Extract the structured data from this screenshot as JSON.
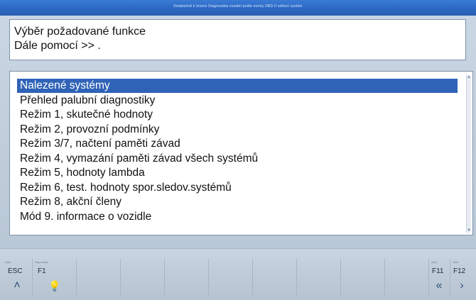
{
  "window": {
    "title": "Dodatečně k licenci Diagnostika vozidel podle normy OBD-II sdílení systém"
  },
  "header": {
    "line1": "Výběr požadované funkce",
    "line2": "Dále pomocí >> ."
  },
  "list": {
    "items": [
      {
        "label": "Nalezené systémy",
        "selected": true
      },
      {
        "label": "Přehled palubní diagnostiky",
        "selected": false
      },
      {
        "label": "Režim 1,  skutečné hodnoty",
        "selected": false
      },
      {
        "label": "Režim 2,  provozní podmínky",
        "selected": false
      },
      {
        "label": "Režim 3/7, načtení paměti závad",
        "selected": false
      },
      {
        "label": "Režim 4,  vymazání paměti závad všech systémů",
        "selected": false
      },
      {
        "label": "Režim 5,  hodnoty lambda",
        "selected": false
      },
      {
        "label": "Režim 6, test. hodnoty spor.sledov.systémů",
        "selected": false
      },
      {
        "label": "Režim 8,  akční členy",
        "selected": false
      },
      {
        "label": "Mód 9. informace o vozidle",
        "selected": false
      }
    ]
  },
  "function_keys": {
    "esc": {
      "label": "ESC",
      "caption": "Zpět",
      "icon": "chevron-up-icon",
      "glyph": "˄"
    },
    "f1": {
      "label": "F1",
      "caption": "Nápověda",
      "icon": "lightbulb-icon",
      "glyph": "💡"
    },
    "f11": {
      "label": "F11",
      "caption": "Zpět",
      "icon": "double-chevron-left-icon",
      "glyph": "«"
    },
    "f12": {
      "label": "F12",
      "caption": "Dále",
      "icon": "chevron-right-icon",
      "glyph": "›"
    }
  },
  "colors": {
    "selection": "#2f63b7",
    "titlebar": "#2d69c4",
    "panel_background": "#ffffff"
  }
}
